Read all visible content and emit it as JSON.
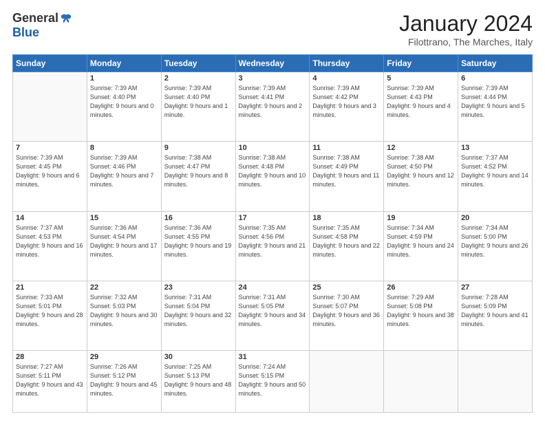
{
  "logo": {
    "general": "General",
    "blue": "Blue"
  },
  "header": {
    "month": "January 2024",
    "location": "Filottrano, The Marches, Italy"
  },
  "weekdays": [
    "Sunday",
    "Monday",
    "Tuesday",
    "Wednesday",
    "Thursday",
    "Friday",
    "Saturday"
  ],
  "weeks": [
    [
      {
        "day": "",
        "sunrise": "",
        "sunset": "",
        "daylight": ""
      },
      {
        "day": "1",
        "sunrise": "Sunrise: 7:39 AM",
        "sunset": "Sunset: 4:40 PM",
        "daylight": "Daylight: 9 hours and 0 minutes."
      },
      {
        "day": "2",
        "sunrise": "Sunrise: 7:39 AM",
        "sunset": "Sunset: 4:40 PM",
        "daylight": "Daylight: 9 hours and 1 minute."
      },
      {
        "day": "3",
        "sunrise": "Sunrise: 7:39 AM",
        "sunset": "Sunset: 4:41 PM",
        "daylight": "Daylight: 9 hours and 2 minutes."
      },
      {
        "day": "4",
        "sunrise": "Sunrise: 7:39 AM",
        "sunset": "Sunset: 4:42 PM",
        "daylight": "Daylight: 9 hours and 3 minutes."
      },
      {
        "day": "5",
        "sunrise": "Sunrise: 7:39 AM",
        "sunset": "Sunset: 4:43 PM",
        "daylight": "Daylight: 9 hours and 4 minutes."
      },
      {
        "day": "6",
        "sunrise": "Sunrise: 7:39 AM",
        "sunset": "Sunset: 4:44 PM",
        "daylight": "Daylight: 9 hours and 5 minutes."
      }
    ],
    [
      {
        "day": "7",
        "sunrise": "Sunrise: 7:39 AM",
        "sunset": "Sunset: 4:45 PM",
        "daylight": "Daylight: 9 hours and 6 minutes."
      },
      {
        "day": "8",
        "sunrise": "Sunrise: 7:39 AM",
        "sunset": "Sunset: 4:46 PM",
        "daylight": "Daylight: 9 hours and 7 minutes."
      },
      {
        "day": "9",
        "sunrise": "Sunrise: 7:38 AM",
        "sunset": "Sunset: 4:47 PM",
        "daylight": "Daylight: 9 hours and 8 minutes."
      },
      {
        "day": "10",
        "sunrise": "Sunrise: 7:38 AM",
        "sunset": "Sunset: 4:48 PM",
        "daylight": "Daylight: 9 hours and 10 minutes."
      },
      {
        "day": "11",
        "sunrise": "Sunrise: 7:38 AM",
        "sunset": "Sunset: 4:49 PM",
        "daylight": "Daylight: 9 hours and 11 minutes."
      },
      {
        "day": "12",
        "sunrise": "Sunrise: 7:38 AM",
        "sunset": "Sunset: 4:50 PM",
        "daylight": "Daylight: 9 hours and 12 minutes."
      },
      {
        "day": "13",
        "sunrise": "Sunrise: 7:37 AM",
        "sunset": "Sunset: 4:52 PM",
        "daylight": "Daylight: 9 hours and 14 minutes."
      }
    ],
    [
      {
        "day": "14",
        "sunrise": "Sunrise: 7:37 AM",
        "sunset": "Sunset: 4:53 PM",
        "daylight": "Daylight: 9 hours and 16 minutes."
      },
      {
        "day": "15",
        "sunrise": "Sunrise: 7:36 AM",
        "sunset": "Sunset: 4:54 PM",
        "daylight": "Daylight: 9 hours and 17 minutes."
      },
      {
        "day": "16",
        "sunrise": "Sunrise: 7:36 AM",
        "sunset": "Sunset: 4:55 PM",
        "daylight": "Daylight: 9 hours and 19 minutes."
      },
      {
        "day": "17",
        "sunrise": "Sunrise: 7:35 AM",
        "sunset": "Sunset: 4:56 PM",
        "daylight": "Daylight: 9 hours and 21 minutes."
      },
      {
        "day": "18",
        "sunrise": "Sunrise: 7:35 AM",
        "sunset": "Sunset: 4:58 PM",
        "daylight": "Daylight: 9 hours and 22 minutes."
      },
      {
        "day": "19",
        "sunrise": "Sunrise: 7:34 AM",
        "sunset": "Sunset: 4:59 PM",
        "daylight": "Daylight: 9 hours and 24 minutes."
      },
      {
        "day": "20",
        "sunrise": "Sunrise: 7:34 AM",
        "sunset": "Sunset: 5:00 PM",
        "daylight": "Daylight: 9 hours and 26 minutes."
      }
    ],
    [
      {
        "day": "21",
        "sunrise": "Sunrise: 7:33 AM",
        "sunset": "Sunset: 5:01 PM",
        "daylight": "Daylight: 9 hours and 28 minutes."
      },
      {
        "day": "22",
        "sunrise": "Sunrise: 7:32 AM",
        "sunset": "Sunset: 5:03 PM",
        "daylight": "Daylight: 9 hours and 30 minutes."
      },
      {
        "day": "23",
        "sunrise": "Sunrise: 7:31 AM",
        "sunset": "Sunset: 5:04 PM",
        "daylight": "Daylight: 9 hours and 32 minutes."
      },
      {
        "day": "24",
        "sunrise": "Sunrise: 7:31 AM",
        "sunset": "Sunset: 5:05 PM",
        "daylight": "Daylight: 9 hours and 34 minutes."
      },
      {
        "day": "25",
        "sunrise": "Sunrise: 7:30 AM",
        "sunset": "Sunset: 5:07 PM",
        "daylight": "Daylight: 9 hours and 36 minutes."
      },
      {
        "day": "26",
        "sunrise": "Sunrise: 7:29 AM",
        "sunset": "Sunset: 5:08 PM",
        "daylight": "Daylight: 9 hours and 38 minutes."
      },
      {
        "day": "27",
        "sunrise": "Sunrise: 7:28 AM",
        "sunset": "Sunset: 5:09 PM",
        "daylight": "Daylight: 9 hours and 41 minutes."
      }
    ],
    [
      {
        "day": "28",
        "sunrise": "Sunrise: 7:27 AM",
        "sunset": "Sunset: 5:11 PM",
        "daylight": "Daylight: 9 hours and 43 minutes."
      },
      {
        "day": "29",
        "sunrise": "Sunrise: 7:26 AM",
        "sunset": "Sunset: 5:12 PM",
        "daylight": "Daylight: 9 hours and 45 minutes."
      },
      {
        "day": "30",
        "sunrise": "Sunrise: 7:25 AM",
        "sunset": "Sunset: 5:13 PM",
        "daylight": "Daylight: 9 hours and 48 minutes."
      },
      {
        "day": "31",
        "sunrise": "Sunrise: 7:24 AM",
        "sunset": "Sunset: 5:15 PM",
        "daylight": "Daylight: 9 hours and 50 minutes."
      },
      {
        "day": "",
        "sunrise": "",
        "sunset": "",
        "daylight": ""
      },
      {
        "day": "",
        "sunrise": "",
        "sunset": "",
        "daylight": ""
      },
      {
        "day": "",
        "sunrise": "",
        "sunset": "",
        "daylight": ""
      }
    ]
  ]
}
